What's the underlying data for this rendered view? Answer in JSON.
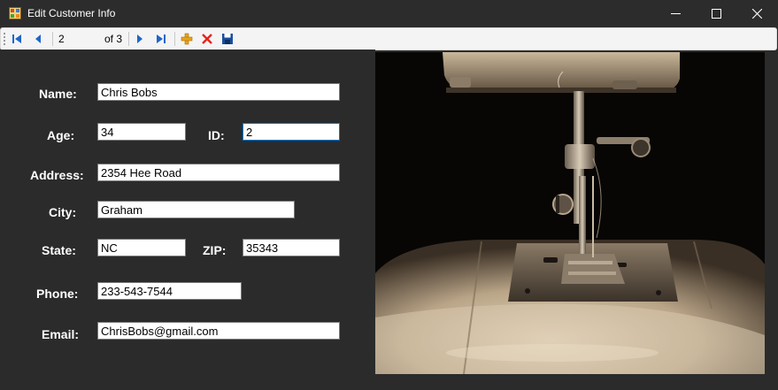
{
  "window": {
    "title": "Edit Customer Info",
    "icons": [
      "app-icon",
      "minimize-icon",
      "maximize-icon",
      "close-icon"
    ]
  },
  "navigator": {
    "position": "2",
    "count_label": "of 3",
    "buttons": [
      "move-first-icon",
      "move-previous-icon",
      "move-next-icon",
      "move-last-icon",
      "add-new-icon",
      "delete-icon",
      "save-icon"
    ]
  },
  "form": {
    "name_label": "Name:",
    "name_value": "Chris Bobs",
    "age_label": "Age:",
    "age_value": "34",
    "id_label": "ID:",
    "id_value": "2",
    "address_label": "Address:",
    "address_value": "2354 Hee Road",
    "city_label": "City:",
    "city_value": "Graham",
    "state_label": "State:",
    "state_value": "NC",
    "zip_label": "ZIP:",
    "zip_value": "35343",
    "phone_label": "Phone:",
    "phone_value": "233-543-7544",
    "email_label": "Email:",
    "email_value": "ChrisBobs@gmail.com"
  },
  "colors": {
    "background": "#2b2b2b",
    "titlebar": "#2c2c2c",
    "toolbar": "#f4f4f4",
    "nav_blue": "#1e66c8",
    "delete_red": "#e8231b",
    "add_gold": "#e8a317",
    "save_blue": "#1a4f9c",
    "focus_border": "#0078d7"
  }
}
